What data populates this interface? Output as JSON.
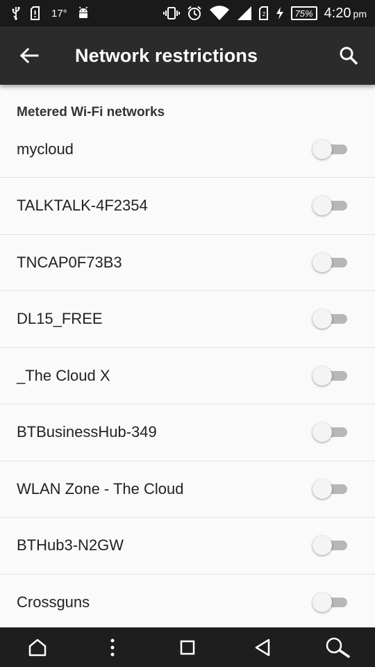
{
  "status_bar": {
    "temperature": "17°",
    "battery_percent": "75%",
    "time": "4:20",
    "am_pm": "pm"
  },
  "app_bar": {
    "title": "Network restrictions"
  },
  "section": {
    "header": "Metered Wi-Fi networks"
  },
  "networks": [
    {
      "name": "mycloud",
      "metered": false
    },
    {
      "name": "TALKTALK-4F2354",
      "metered": false
    },
    {
      "name": "TNCAP0F73B3",
      "metered": false
    },
    {
      "name": "DL15_FREE",
      "metered": false
    },
    {
      "name": "_The Cloud X",
      "metered": false
    },
    {
      "name": "BTBusinessHub-349",
      "metered": false
    },
    {
      "name": "WLAN Zone - The Cloud",
      "metered": false
    },
    {
      "name": "BTHub3-N2GW",
      "metered": false
    },
    {
      "name": "Crossguns",
      "metered": false
    }
  ],
  "icons": {
    "status_left": [
      "usb-icon",
      "sim-alert-icon",
      "android-icon"
    ],
    "status_right": [
      "vibrate-icon",
      "alarm-icon",
      "wifi-icon",
      "signal-icon",
      "sim-icon",
      "charging-icon"
    ],
    "nav": [
      "home-icon",
      "menu-dots-icon",
      "recents-icon",
      "back-triangle-icon",
      "search-icon"
    ]
  },
  "colors": {
    "status_bar_bg": "#1a1a1a",
    "app_bar_bg": "#2b2b2b",
    "content_bg": "#fafafa",
    "nav_bar_bg": "#1e1e1e",
    "toggle_off_track": "#b7b7b7"
  }
}
